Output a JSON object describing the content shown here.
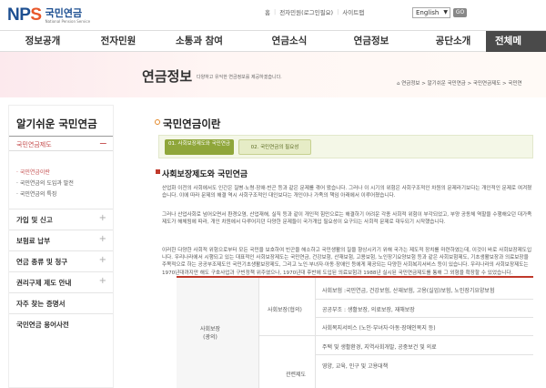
{
  "logo": {
    "mark_left": "NP",
    "mark_s": "S",
    "name": "국민연금",
    "sub": "National Pension Service"
  },
  "util_links": [
    "홈",
    "전자민원(로그인필요)",
    "사이트맵"
  ],
  "lang_select": {
    "value": "English"
  },
  "go_label": "GO",
  "gnb": [
    "정보공개",
    "전자민원",
    "소통과 참여",
    "연금소식",
    "연금정보",
    "공단소개",
    "전체메"
  ],
  "hero": {
    "title": "연금정보",
    "desc": "다양하고 유익한 연금정보를 제공하겠습니다.",
    "breadcrumb": "연금정보 > 알기쉬운 국민연금 > 국민연금제도 > 국민연"
  },
  "sidebar": {
    "title": "알기쉬운 국민연금",
    "active": "국민연금제도",
    "sub_items": [
      "국민연금이란",
      "국민연금의 도입과 발전",
      "국민연금의 특징"
    ],
    "menus": [
      "가입 및 신고",
      "보험료 납부",
      "연금 종류 및 청구",
      "권리구제 제도 안내",
      "자주 찾는 증명서",
      "국민연금 용어사전"
    ]
  },
  "content": {
    "title": "국민연금이란",
    "tabs": [
      {
        "num": "01.",
        "label": "사회보장제도와 국민연금"
      },
      {
        "num": "02.",
        "label": "국민연금의 필요성"
      }
    ],
    "section_head": "사회보장제도와 국민연금",
    "para1": "산업화 이전의 사회에서도 인간은 질병·노령·장애·빈곤 등과 같은 문제를 겪어 왔습니다. 그러나 이 시기의 위험은 사회구조적인 차원의 문제라기보다는 개인적인 문제로 여겨졌습니다. 이에 따라 문제의 해결 역시 사회구조적인 대인보다는 개인이나 가족의 책임 아래에서 이루어졌습니다.",
    "para2": "그러나 산업사회로 넘어오면서 환경오염, 산업재해, 실직 등과 같이 개인적 힘만으로는 해결하기 어려운 각종 사회적 위험이 부각되었고, 부양 공동체 역할을 수행해오던 대가족 제도가 해체됨에 따라, 개인 차원에서 다루어지던 다양한 문제들이 국가개입 필요성이 요구되는 사회적 문제로 대두되기 시작했습니다.",
    "para3": "이러한 다양한 사회적 위험으로부터 모든 국민을 보호하여 빈곤을 해소하고 국민생활의 질을 향상시키기 위해 국가는 제도적 장치를 마련하였는데, 이것이 바로 사회보장제도입니다. 우리나라에서 시행되고 있는 대표적인 사회보장제도는 국민연금, 건강보험, 산재보험, 고용보험, 노인장기요양보험 등과 같은 사회보험제도, 기초생활보장과 의료보장을 주목적으로 하는 공공부조제도인 국민기초생활보장제도, 그리고 노인·부녀자·아동·장애인 등에게 제공되는 다양한 사회복지서비스 등이 있습니다. 우리나라의 사회보장제도는 1970년대까지만 해도 구호사업과 구빈정책 위주였으나, 1970년대 후반에 도입된 의료보험과 1988년 실시된 국민연금제도를 통해 그 외형을 확장할 수 있었습니다."
  },
  "table": {
    "col0": "사회보장\n(광의)",
    "group1": "사회보장(협의)",
    "group2": "관련제도",
    "rows": [
      "사회보험 :국민연금, 건강보험, 산재보험, 고용(실업)보험, 노인장기요양보험",
      "공공부조 : 생활보장, 의료보장, 재해보장",
      "사회복지서비스 (노인·부녀자·아동·장애인복지 등)",
      "주택 및 생활환경, 지역사회개발, 공중보건 및 의료",
      "영양, 교육, 인구 및 고용대책"
    ]
  }
}
